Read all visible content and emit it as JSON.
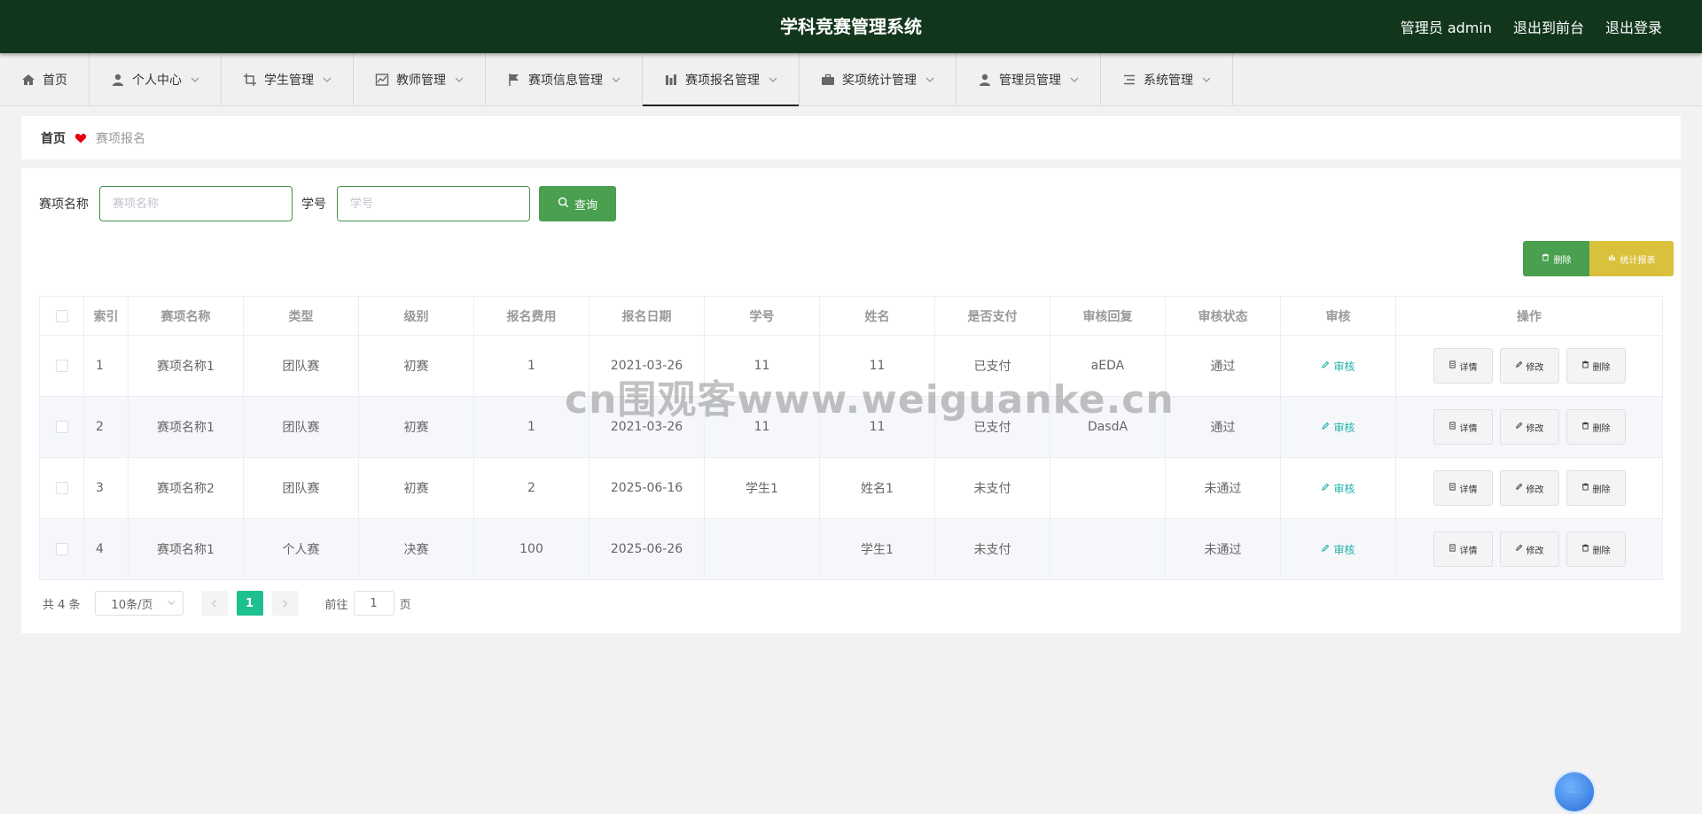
{
  "header": {
    "title": "学科竞赛管理系统",
    "user": "管理员 admin",
    "to_front": "退出到前台",
    "logout": "退出登录"
  },
  "nav": [
    {
      "label": "首页",
      "icon": "home-icon",
      "has_menu": false
    },
    {
      "label": "个人中心",
      "icon": "user-icon",
      "has_menu": true
    },
    {
      "label": "学生管理",
      "icon": "crop-icon",
      "has_menu": true
    },
    {
      "label": "教师管理",
      "icon": "chart-icon",
      "has_menu": true
    },
    {
      "label": "赛项信息管理",
      "icon": "flag-icon",
      "has_menu": true
    },
    {
      "label": "赛项报名管理",
      "icon": "bar-icon",
      "has_menu": true,
      "active": true
    },
    {
      "label": "奖项统计管理",
      "icon": "briefcase-icon",
      "has_menu": true
    },
    {
      "label": "管理员管理",
      "icon": "user-icon",
      "has_menu": true
    },
    {
      "label": "系统管理",
      "icon": "list-icon",
      "has_menu": true
    }
  ],
  "breadcrumb": {
    "home": "首页",
    "current": "赛项报名"
  },
  "search": {
    "name_label": "赛项名称",
    "name_placeholder": "赛项名称",
    "id_label": "学号",
    "id_placeholder": "学号",
    "query_label": "查询"
  },
  "toolbar": {
    "delete_label": "删除",
    "stats_label": "统计报表"
  },
  "table": {
    "columns": [
      "索引",
      "赛项名称",
      "类型",
      "级别",
      "报名费用",
      "报名日期",
      "学号",
      "姓名",
      "是否支付",
      "审核回复",
      "审核状态",
      "审核",
      "操作"
    ],
    "rows": [
      [
        "1",
        "赛项名称1",
        "团队赛",
        "初赛",
        "1",
        "2021-03-26",
        "11",
        "11",
        "已支付",
        "aEDA",
        "通过"
      ],
      [
        "2",
        "赛项名称1",
        "团队赛",
        "初赛",
        "1",
        "2021-03-26",
        "11",
        "11",
        "已支付",
        "DasdA",
        "通过"
      ],
      [
        "3",
        "赛项名称2",
        "团队赛",
        "初赛",
        "2",
        "2025-06-16",
        "学生1",
        "姓名1",
        "未支付",
        "",
        "未通过"
      ],
      [
        "4",
        "赛项名称1",
        "个人赛",
        "决赛",
        "100",
        "2025-06-26",
        "",
        "学生1",
        "未支付",
        "",
        "未通过"
      ]
    ],
    "audit_label": "审核",
    "detail_label": "详情",
    "edit_label": "修改",
    "delete_label": "删除"
  },
  "pager": {
    "total": "共 4 条",
    "page_size": "10条/页",
    "current": "1",
    "goto_prefix": "前往",
    "goto_value": "1",
    "goto_suffix": "页"
  },
  "watermark": "cn围观客www.weiguanke.cn",
  "colors": {
    "header_bg": "#12361c",
    "primary": "#4aa04f",
    "warning": "#d9c13b",
    "page_active": "#1ec08f",
    "audit": "#20b2aa"
  }
}
